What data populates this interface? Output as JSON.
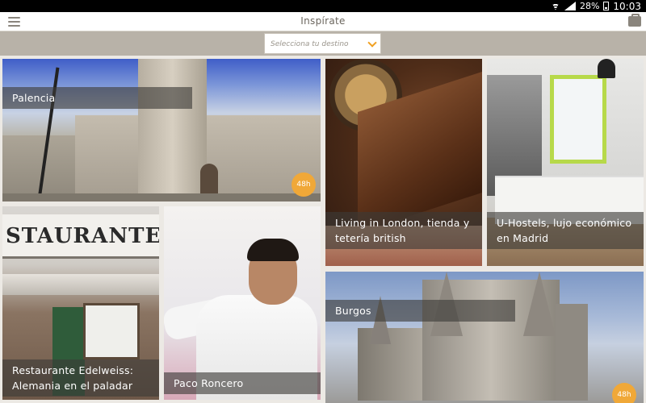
{
  "status_bar": {
    "battery": "28%",
    "time": "10:03",
    "icons": [
      "wifi-icon",
      "signal-icon",
      "battery-icon"
    ]
  },
  "app_bar": {
    "title": "Inspírate",
    "menu_icon": "hamburger-menu-icon",
    "right_icon": "bag-icon"
  },
  "filter": {
    "destination_placeholder": "Selecciona tu destino",
    "chevron_icon": "chevron-down-icon",
    "accent_color": "#f0a020"
  },
  "cards": {
    "palencia": {
      "title": "Palencia",
      "badge": "48h"
    },
    "london": {
      "title_line1": "Living in London, tienda y",
      "title_line2": "tetería british"
    },
    "uhostels": {
      "title_line1": "U-Hostels, lujo económico",
      "title_line2": "en Madrid"
    },
    "restaurante": {
      "title_line1": "Restaurante Edelweiss:",
      "title_line2": "Alemania en el paladar",
      "sign_text": "STAURANTE"
    },
    "paco": {
      "title": "Paco Roncero"
    },
    "burgos": {
      "title": "Burgos",
      "badge": "48h"
    }
  },
  "colors": {
    "badge": "#f0a838",
    "filter_bar": "#b8b2a8",
    "caption_overlay": "rgba(60,58,55,0.62)"
  }
}
